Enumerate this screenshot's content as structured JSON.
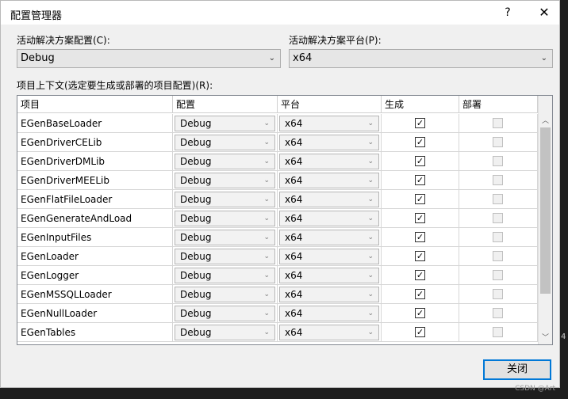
{
  "window": {
    "title": "配置管理器",
    "help_glyph": "?",
    "close_glyph": "✕"
  },
  "solution": {
    "config_label": "活动解决方案配置(C):",
    "config_value": "Debug",
    "platform_label": "活动解决方案平台(P):",
    "platform_value": "x64"
  },
  "contexts": {
    "label": "项目上下文(选定要生成或部署的项目配置)(R):",
    "columns": {
      "project": "项目",
      "config": "配置",
      "platform": "平台",
      "build": "生成",
      "deploy": "部署"
    },
    "rows": [
      {
        "project": "EGenBaseLoader",
        "config": "Debug",
        "platform": "x64",
        "build": true,
        "deploy": false
      },
      {
        "project": "EGenDriverCELib",
        "config": "Debug",
        "platform": "x64",
        "build": true,
        "deploy": false
      },
      {
        "project": "EGenDriverDMLib",
        "config": "Debug",
        "platform": "x64",
        "build": true,
        "deploy": false
      },
      {
        "project": "EGenDriverMEELib",
        "config": "Debug",
        "platform": "x64",
        "build": true,
        "deploy": false
      },
      {
        "project": "EGenFlatFileLoader",
        "config": "Debug",
        "platform": "x64",
        "build": true,
        "deploy": false
      },
      {
        "project": "EGenGenerateAndLoad",
        "config": "Debug",
        "platform": "x64",
        "build": true,
        "deploy": false
      },
      {
        "project": "EGenInputFiles",
        "config": "Debug",
        "platform": "x64",
        "build": true,
        "deploy": false
      },
      {
        "project": "EGenLoader",
        "config": "Debug",
        "platform": "x64",
        "build": true,
        "deploy": false
      },
      {
        "project": "EGenLogger",
        "config": "Debug",
        "platform": "x64",
        "build": true,
        "deploy": false
      },
      {
        "project": "EGenMSSQLLoader",
        "config": "Debug",
        "platform": "x64",
        "build": true,
        "deploy": false
      },
      {
        "project": "EGenNullLoader",
        "config": "Debug",
        "platform": "x64",
        "build": true,
        "deploy": false
      },
      {
        "project": "EGenTables",
        "config": "Debug",
        "platform": "x64",
        "build": true,
        "deploy": false
      }
    ]
  },
  "buttons": {
    "close": "关闭"
  },
  "icons": {
    "chevron": "chevron-down-icon",
    "scroll_up": "scroll-up-arrow-icon",
    "scroll_down": "scroll-down-arrow-icon",
    "check": "checkmark-icon"
  },
  "backdrop": {
    "edge_digit": "4"
  },
  "watermark": "CSDN @Art",
  "colors": {
    "focus_border": "#0078d7",
    "dialog_bg": "#f0f0f0"
  }
}
